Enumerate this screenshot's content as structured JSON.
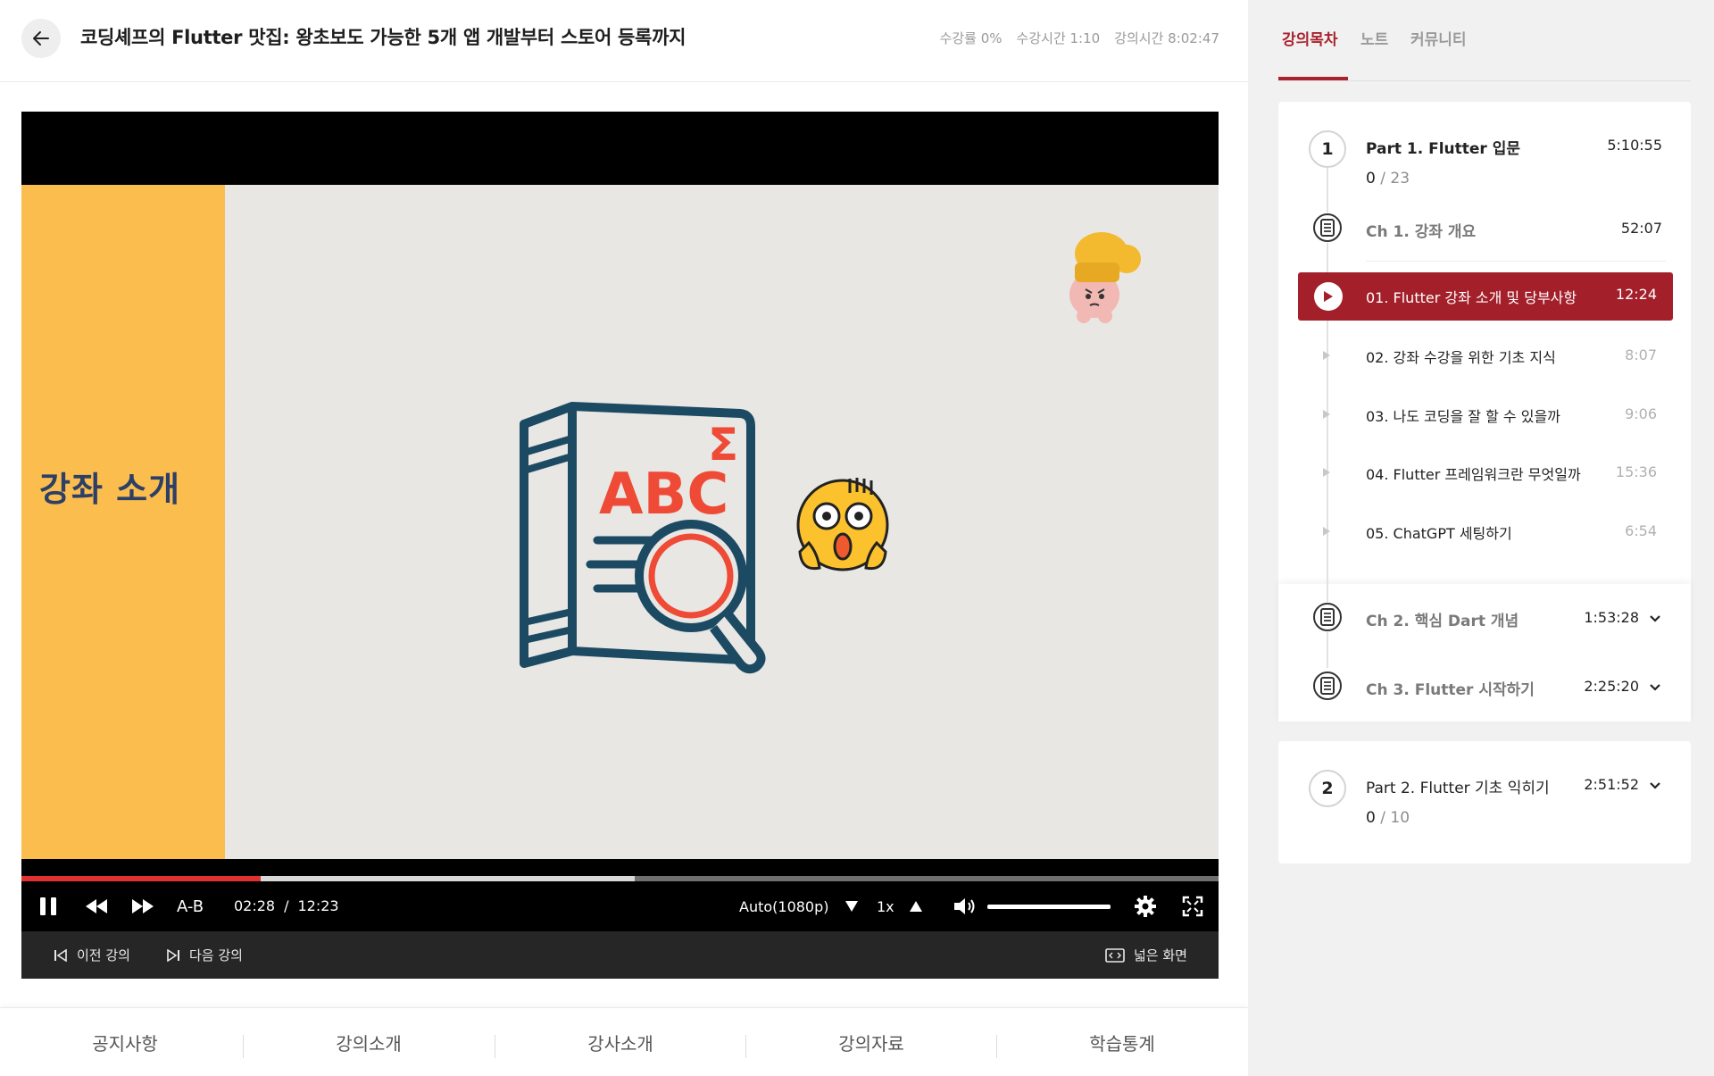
{
  "header": {
    "title": "코딩셰프의 Flutter 맛집: 왕초보도 가능한 5개 앱 개발부터 스토어 등록까지",
    "stats": [
      "수강률 0%",
      "수강시간 1:10",
      "강의시간 8:02:47"
    ]
  },
  "slide": {
    "title": "강좌 소개",
    "book_text": "ABC",
    "book_symbol": "Σ"
  },
  "player": {
    "progress_fraction": 0.2,
    "buffer_fraction": 0.512,
    "ab_label": "A-B",
    "current_time": "02:28",
    "separator": "/",
    "duration": "12:23",
    "quality": "Auto(1080p)",
    "speed": "1x",
    "volume_fraction": 1.0
  },
  "subbar": {
    "prev": "이전 강의",
    "next": "다음 강의",
    "wide": "넓은 화면"
  },
  "bottom_tabs": [
    "공지사항",
    "강의소개",
    "강사소개",
    "강의자료",
    "학습통계"
  ],
  "sidebar": {
    "tabs": [
      "강의목차",
      "노트",
      "커뮤니티"
    ],
    "part1": {
      "number": "1",
      "title": "Part 1. Flutter 입문",
      "time": "5:10:55",
      "done": "0",
      "sep": " / ",
      "total": "23"
    },
    "ch1": {
      "title": "Ch 1. 강좌 개요",
      "time": "52:07"
    },
    "lessons": [
      {
        "label": "01. Flutter 강좌 소개 및 당부사항",
        "time": "12:24"
      },
      {
        "label": "02. 강좌 수강을 위한 기초 지식",
        "time": "8:07"
      },
      {
        "label": "03. 나도 코딩을 잘 할 수 있을까",
        "time": "9:06"
      },
      {
        "label": "04. Flutter 프레임워크란 무엇일까",
        "time": "15:36"
      },
      {
        "label": "05. ChatGPT 세팅하기",
        "time": "6:54"
      }
    ],
    "ch2": {
      "title": "Ch 2. 핵심 Dart 개념",
      "time": "1:53:28"
    },
    "ch3": {
      "title": "Ch 3. Flutter 시작하기",
      "time": "2:25:20"
    },
    "part2": {
      "number": "2",
      "title": "Part 2. Flutter 기초 익히기",
      "time": "2:51:52",
      "done": "0",
      "sep": " / ",
      "total": "10"
    }
  },
  "colors": {
    "accent": "#a3202b",
    "progress": "#e0302f",
    "slide_band": "#fbbd4e",
    "slide_title": "#2d3f66"
  }
}
